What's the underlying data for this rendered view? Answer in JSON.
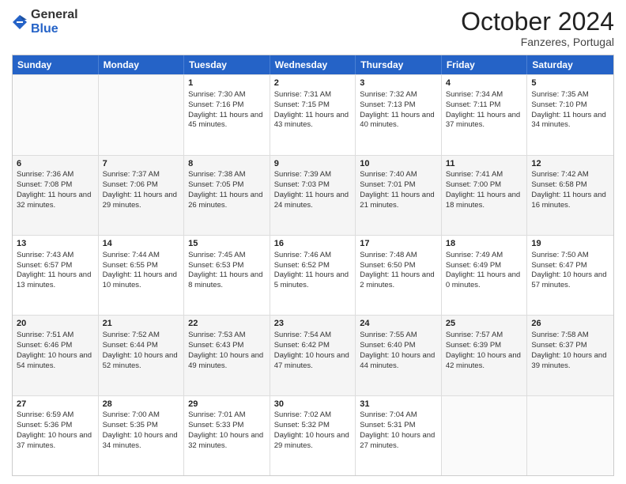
{
  "logo": {
    "general": "General",
    "blue": "Blue"
  },
  "header": {
    "month": "October 2024",
    "location": "Fanzeres, Portugal"
  },
  "weekdays": [
    "Sunday",
    "Monday",
    "Tuesday",
    "Wednesday",
    "Thursday",
    "Friday",
    "Saturday"
  ],
  "rows": [
    [
      {
        "day": "",
        "sunrise": "",
        "sunset": "",
        "daylight": "",
        "empty": true
      },
      {
        "day": "",
        "sunrise": "",
        "sunset": "",
        "daylight": "",
        "empty": true
      },
      {
        "day": "1",
        "sunrise": "Sunrise: 7:30 AM",
        "sunset": "Sunset: 7:16 PM",
        "daylight": "Daylight: 11 hours and 45 minutes."
      },
      {
        "day": "2",
        "sunrise": "Sunrise: 7:31 AM",
        "sunset": "Sunset: 7:15 PM",
        "daylight": "Daylight: 11 hours and 43 minutes."
      },
      {
        "day": "3",
        "sunrise": "Sunrise: 7:32 AM",
        "sunset": "Sunset: 7:13 PM",
        "daylight": "Daylight: 11 hours and 40 minutes."
      },
      {
        "day": "4",
        "sunrise": "Sunrise: 7:34 AM",
        "sunset": "Sunset: 7:11 PM",
        "daylight": "Daylight: 11 hours and 37 minutes."
      },
      {
        "day": "5",
        "sunrise": "Sunrise: 7:35 AM",
        "sunset": "Sunset: 7:10 PM",
        "daylight": "Daylight: 11 hours and 34 minutes."
      }
    ],
    [
      {
        "day": "6",
        "sunrise": "Sunrise: 7:36 AM",
        "sunset": "Sunset: 7:08 PM",
        "daylight": "Daylight: 11 hours and 32 minutes."
      },
      {
        "day": "7",
        "sunrise": "Sunrise: 7:37 AM",
        "sunset": "Sunset: 7:06 PM",
        "daylight": "Daylight: 11 hours and 29 minutes."
      },
      {
        "day": "8",
        "sunrise": "Sunrise: 7:38 AM",
        "sunset": "Sunset: 7:05 PM",
        "daylight": "Daylight: 11 hours and 26 minutes."
      },
      {
        "day": "9",
        "sunrise": "Sunrise: 7:39 AM",
        "sunset": "Sunset: 7:03 PM",
        "daylight": "Daylight: 11 hours and 24 minutes."
      },
      {
        "day": "10",
        "sunrise": "Sunrise: 7:40 AM",
        "sunset": "Sunset: 7:01 PM",
        "daylight": "Daylight: 11 hours and 21 minutes."
      },
      {
        "day": "11",
        "sunrise": "Sunrise: 7:41 AM",
        "sunset": "Sunset: 7:00 PM",
        "daylight": "Daylight: 11 hours and 18 minutes."
      },
      {
        "day": "12",
        "sunrise": "Sunrise: 7:42 AM",
        "sunset": "Sunset: 6:58 PM",
        "daylight": "Daylight: 11 hours and 16 minutes."
      }
    ],
    [
      {
        "day": "13",
        "sunrise": "Sunrise: 7:43 AM",
        "sunset": "Sunset: 6:57 PM",
        "daylight": "Daylight: 11 hours and 13 minutes."
      },
      {
        "day": "14",
        "sunrise": "Sunrise: 7:44 AM",
        "sunset": "Sunset: 6:55 PM",
        "daylight": "Daylight: 11 hours and 10 minutes."
      },
      {
        "day": "15",
        "sunrise": "Sunrise: 7:45 AM",
        "sunset": "Sunset: 6:53 PM",
        "daylight": "Daylight: 11 hours and 8 minutes."
      },
      {
        "day": "16",
        "sunrise": "Sunrise: 7:46 AM",
        "sunset": "Sunset: 6:52 PM",
        "daylight": "Daylight: 11 hours and 5 minutes."
      },
      {
        "day": "17",
        "sunrise": "Sunrise: 7:48 AM",
        "sunset": "Sunset: 6:50 PM",
        "daylight": "Daylight: 11 hours and 2 minutes."
      },
      {
        "day": "18",
        "sunrise": "Sunrise: 7:49 AM",
        "sunset": "Sunset: 6:49 PM",
        "daylight": "Daylight: 11 hours and 0 minutes."
      },
      {
        "day": "19",
        "sunrise": "Sunrise: 7:50 AM",
        "sunset": "Sunset: 6:47 PM",
        "daylight": "Daylight: 10 hours and 57 minutes."
      }
    ],
    [
      {
        "day": "20",
        "sunrise": "Sunrise: 7:51 AM",
        "sunset": "Sunset: 6:46 PM",
        "daylight": "Daylight: 10 hours and 54 minutes."
      },
      {
        "day": "21",
        "sunrise": "Sunrise: 7:52 AM",
        "sunset": "Sunset: 6:44 PM",
        "daylight": "Daylight: 10 hours and 52 minutes."
      },
      {
        "day": "22",
        "sunrise": "Sunrise: 7:53 AM",
        "sunset": "Sunset: 6:43 PM",
        "daylight": "Daylight: 10 hours and 49 minutes."
      },
      {
        "day": "23",
        "sunrise": "Sunrise: 7:54 AM",
        "sunset": "Sunset: 6:42 PM",
        "daylight": "Daylight: 10 hours and 47 minutes."
      },
      {
        "day": "24",
        "sunrise": "Sunrise: 7:55 AM",
        "sunset": "Sunset: 6:40 PM",
        "daylight": "Daylight: 10 hours and 44 minutes."
      },
      {
        "day": "25",
        "sunrise": "Sunrise: 7:57 AM",
        "sunset": "Sunset: 6:39 PM",
        "daylight": "Daylight: 10 hours and 42 minutes."
      },
      {
        "day": "26",
        "sunrise": "Sunrise: 7:58 AM",
        "sunset": "Sunset: 6:37 PM",
        "daylight": "Daylight: 10 hours and 39 minutes."
      }
    ],
    [
      {
        "day": "27",
        "sunrise": "Sunrise: 6:59 AM",
        "sunset": "Sunset: 5:36 PM",
        "daylight": "Daylight: 10 hours and 37 minutes."
      },
      {
        "day": "28",
        "sunrise": "Sunrise: 7:00 AM",
        "sunset": "Sunset: 5:35 PM",
        "daylight": "Daylight: 10 hours and 34 minutes."
      },
      {
        "day": "29",
        "sunrise": "Sunrise: 7:01 AM",
        "sunset": "Sunset: 5:33 PM",
        "daylight": "Daylight: 10 hours and 32 minutes."
      },
      {
        "day": "30",
        "sunrise": "Sunrise: 7:02 AM",
        "sunset": "Sunset: 5:32 PM",
        "daylight": "Daylight: 10 hours and 29 minutes."
      },
      {
        "day": "31",
        "sunrise": "Sunrise: 7:04 AM",
        "sunset": "Sunset: 5:31 PM",
        "daylight": "Daylight: 10 hours and 27 minutes."
      },
      {
        "day": "",
        "sunrise": "",
        "sunset": "",
        "daylight": "",
        "empty": true
      },
      {
        "day": "",
        "sunrise": "",
        "sunset": "",
        "daylight": "",
        "empty": true
      }
    ]
  ]
}
